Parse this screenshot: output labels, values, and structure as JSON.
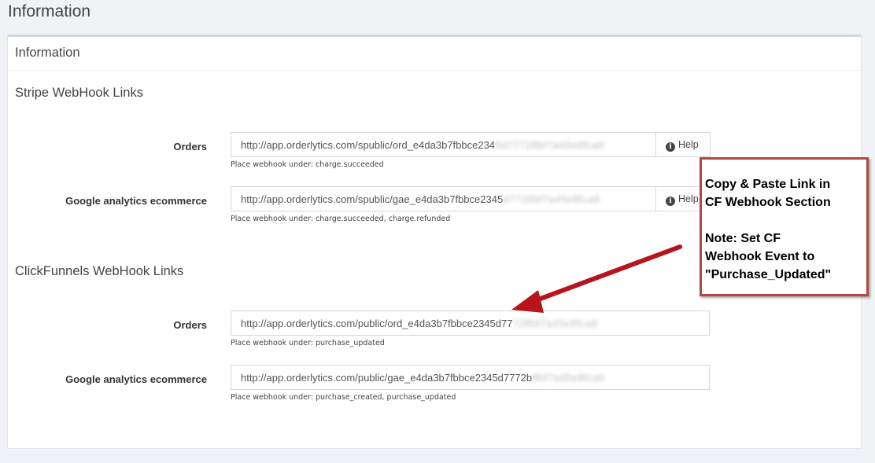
{
  "page": {
    "title": "Information"
  },
  "panel": {
    "title": "Information"
  },
  "stripe": {
    "section_title": "Stripe WebHook Links",
    "rows": [
      {
        "label": "Orders",
        "url_visible": "http://app.orderlytics.com/spublic/ord_e4da3b7fbbce234",
        "url_obscured": "5d77728bf7a45e8fca9",
        "hint": "Place webhook under: charge.succeeded",
        "help_label": "Help"
      },
      {
        "label": "Google analytics ecommerce",
        "url_visible": "http://app.orderlytics.com/spublic/gae_e4da3b7fbbce2345",
        "url_obscured": "d7728bf7a45e8fca9",
        "hint": "Place webhook under: charge.succeeded, charge.refunded",
        "help_label": "Help"
      }
    ]
  },
  "clickfunnels": {
    "section_title": "ClickFunnels WebHook Links",
    "rows": [
      {
        "label": "Orders",
        "url_visible": "http://app.orderlytics.com/public/ord_e4da3b7fbbce2345d77",
        "url_obscured": "728bf7a45e8fca9",
        "hint": "Place webhook under: purchase_updated"
      },
      {
        "label": "Google analytics ecommerce",
        "url_visible": "http://app.orderlytics.com/public/gae_e4da3b7fbbce2345d7772b",
        "url_obscured": "8bf7a45e8fca9",
        "hint": "Place webhook under: purchase_created, purchase_updated"
      }
    ]
  },
  "callout": {
    "line1": "Copy & Paste Link in\nCF Webhook Section",
    "line2": "Note:  Set CF\nWebhook Event to\n\"Purchase_Updated\""
  },
  "colors": {
    "callout_border": "#b04a3e",
    "arrow": "#b8141b"
  },
  "icons": {
    "help": "info-circle-icon"
  }
}
